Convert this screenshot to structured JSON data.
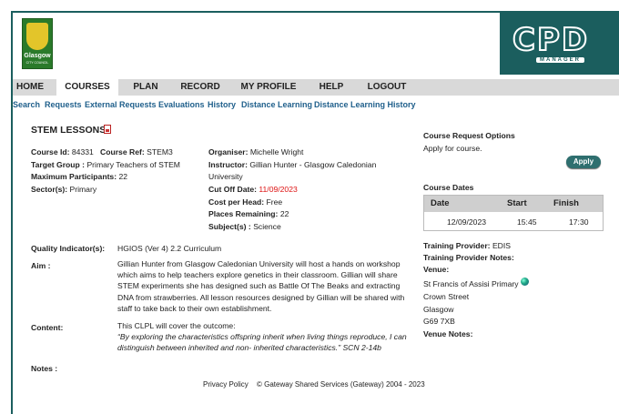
{
  "header": {
    "logo_text": "Glasgow",
    "logo_subtext": "CITY COUNCIL",
    "brand_title": "CPD",
    "brand_subtitle": "MANAGER"
  },
  "nav": {
    "items": [
      {
        "label": "HOME"
      },
      {
        "label": "COURSES"
      },
      {
        "label": "PLAN"
      },
      {
        "label": "RECORD"
      },
      {
        "label": "MY PROFILE"
      },
      {
        "label": "HELP"
      },
      {
        "label": "LOGOUT"
      }
    ],
    "active": "COURSES"
  },
  "subnav": {
    "items": [
      {
        "label": "Search"
      },
      {
        "label": "Requests"
      },
      {
        "label": "External Requests"
      },
      {
        "label": "Evaluations"
      },
      {
        "label": "History"
      },
      {
        "label": "Distance Learning"
      },
      {
        "label": "Distance Learning History"
      }
    ]
  },
  "course": {
    "title": "STEM LESSONS",
    "id_label": "Course Id:",
    "id_value": "84331",
    "ref_label": "Course Ref:",
    "ref_value": "STEM3",
    "target_label": "Target Group :",
    "target_value": "Primary Teachers of STEM",
    "max_label": "Maximum Participants:",
    "max_value": "22",
    "sector_label": "Sector(s):",
    "sector_value": "Primary",
    "organiser_label": "Organiser:",
    "organiser_value": "Michelle Wright",
    "instructor_label": "Instructor:",
    "instructor_value": "Gillian Hunter - Glasgow Caledonian",
    "instructor_value2": "University",
    "cutoff_label": "Cut Off Date:",
    "cutoff_value": "11/09/2023",
    "cost_label": "Cost per Head:",
    "cost_value": "Free",
    "places_label": "Places Remaining:",
    "places_value": "22",
    "subjects_label": "Subject(s) :",
    "subjects_value": "Science",
    "quality_label": "Quality Indicator(s):",
    "quality_value": "HGIOS (Ver 4) 2.2 Curriculum",
    "aim_label": "Aim :",
    "aim_lines": [
      "Gillian Hunter from Glasgow Caledonian University will host a hands on workshop",
      "which aims to help teachers explore genetics in their classroom. Gillian will share",
      "STEM experiments she has designed such as Battle Of The Beaks and extracting",
      "DNA from strawberries. All lesson resources designed by Gillian will be shared with",
      "staff to take back to their own establishment."
    ],
    "content_label": "Content:",
    "content_intro": "This CLPL will cover the outcome:",
    "content_quote_lines": [
      "“By exploring the characteristics offspring inherit when living things reproduce, I can",
      "distinguish between inherited and non- inherited characteristics.” SCN 2-14b"
    ],
    "notes_label": "Notes :"
  },
  "sidebar": {
    "request_title": "Course Request Options",
    "request_text": "Apply for course.",
    "apply_label": "Apply",
    "dates_title": "Course Dates",
    "dates_headers": [
      "Date",
      "Start",
      "Finish"
    ],
    "dates_row": [
      "12/09/2023",
      "15:45",
      "17:30"
    ],
    "provider_label": "Training Provider:",
    "provider_value": "EDIS",
    "provider_notes_label": "Training Provider Notes:",
    "venue_label": "Venue:",
    "venue_lines": [
      "St Francis of Assisi Primary",
      "Crown Street",
      "Glasgow",
      "G69 7XB"
    ],
    "venue_notes_label": "Venue Notes:"
  },
  "footer": {
    "privacy_label": "Privacy Policy",
    "copyright": "© Gateway Shared Services (Gateway) 2004 - 2023"
  },
  "colors": {
    "brand_teal": "#1b5e5e",
    "link_blue": "#1f5f8b",
    "nav_gray": "#d9d9d9",
    "cutoff_red": "#dd1111"
  }
}
